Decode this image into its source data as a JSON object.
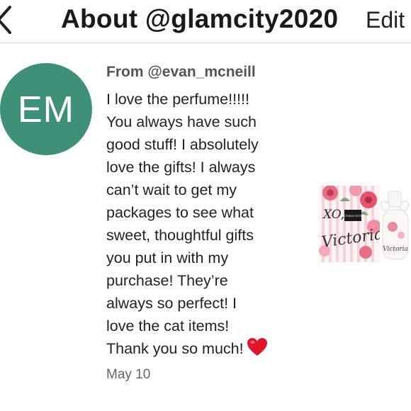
{
  "header": {
    "title": "About @glamcity2020",
    "edit_label": "Edit"
  },
  "review": {
    "avatar_initials": "EM",
    "from_label": "From @evan_mcneill",
    "message_lines": [
      "I love the perfume!!!!!",
      "You always have such",
      "good stuff! I absolutely",
      "love the gifts! I always",
      "can’t wait to get my",
      "packages to see what",
      "sweet, thoughtful gifts",
      "you put in with my",
      "purchase! They’re",
      "always so perfect! I",
      "love the cat items!",
      "Thank you so much!"
    ],
    "date": "May 10"
  },
  "product": {
    "box_text_top": "XO,",
    "box_brand": "VICTORIA'S SECRET",
    "box_script": "Victoria",
    "bottle_script": "Victoria"
  },
  "colors": {
    "avatar_bg": "#3e9079",
    "heart": "#e0142a",
    "divider": "#dcdcdc"
  },
  "icons": {
    "back": "chevron-left-icon",
    "heart": "red-heart-icon"
  }
}
